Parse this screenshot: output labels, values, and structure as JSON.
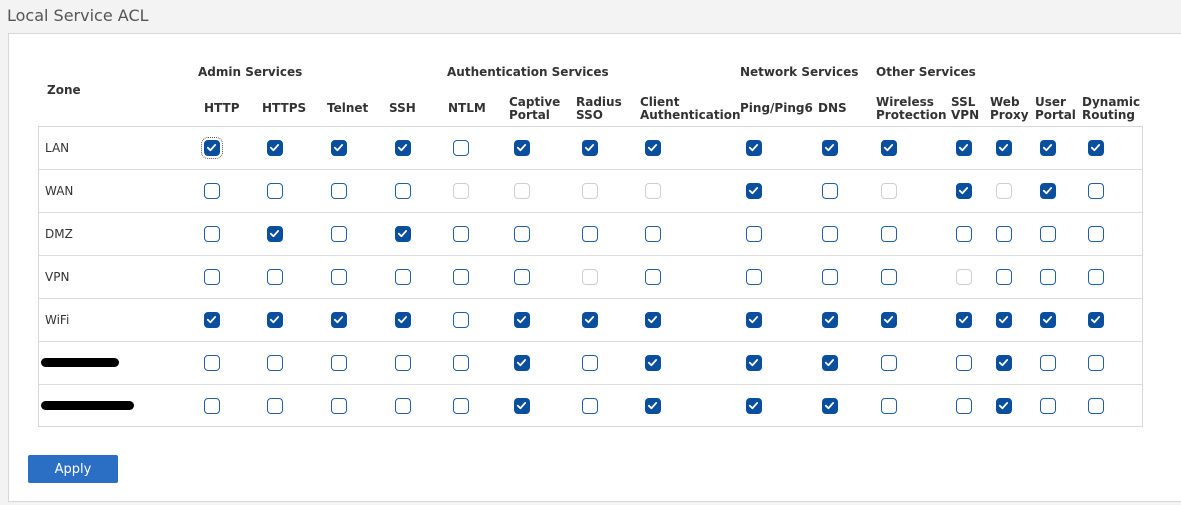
{
  "page": {
    "title": "Local Service ACL"
  },
  "table": {
    "zone_header": "Zone",
    "groups": [
      {
        "label": "Admin Services"
      },
      {
        "label": "Authentication Services"
      },
      {
        "label": "Network Services"
      },
      {
        "label": "Other Services"
      }
    ],
    "columns": [
      {
        "label": "HTTP"
      },
      {
        "label": "HTTPS"
      },
      {
        "label": "Telnet"
      },
      {
        "label": "SSH"
      },
      {
        "label": "NTLM"
      },
      {
        "label": "Captive\nPortal"
      },
      {
        "label": "Radius\nSSO"
      },
      {
        "label": "Client\nAuthentication"
      },
      {
        "label": "Ping/Ping6"
      },
      {
        "label": "DNS"
      },
      {
        "label": "Wireless\nProtection"
      },
      {
        "label": "SSL\nVPN"
      },
      {
        "label": "Web\nProxy"
      },
      {
        "label": "User\nPortal"
      },
      {
        "label": "Dynamic\nRouting"
      }
    ],
    "rows": [
      {
        "zone": "LAN",
        "redacted": false,
        "cells": [
          "checked",
          "checked",
          "checked",
          "checked",
          "unchecked",
          "checked",
          "checked",
          "checked",
          "checked",
          "checked",
          "checked",
          "checked",
          "checked",
          "checked",
          "checked"
        ]
      },
      {
        "zone": "WAN",
        "redacted": false,
        "cells": [
          "unchecked",
          "unchecked",
          "unchecked",
          "unchecked",
          "disabled",
          "disabled",
          "disabled",
          "disabled",
          "checked",
          "unchecked",
          "disabled",
          "checked",
          "disabled",
          "checked",
          "unchecked"
        ]
      },
      {
        "zone": "DMZ",
        "redacted": false,
        "cells": [
          "unchecked",
          "checked",
          "unchecked",
          "checked",
          "unchecked",
          "unchecked",
          "unchecked",
          "unchecked",
          "unchecked",
          "unchecked",
          "unchecked",
          "unchecked",
          "unchecked",
          "unchecked",
          "unchecked"
        ]
      },
      {
        "zone": "VPN",
        "redacted": false,
        "cells": [
          "unchecked",
          "unchecked",
          "unchecked",
          "unchecked",
          "unchecked",
          "unchecked",
          "disabled",
          "unchecked",
          "unchecked",
          "unchecked",
          "unchecked",
          "disabled",
          "unchecked",
          "unchecked",
          "unchecked"
        ]
      },
      {
        "zone": "WiFi",
        "redacted": false,
        "cells": [
          "checked",
          "checked",
          "checked",
          "checked",
          "unchecked",
          "checked",
          "checked",
          "checked",
          "checked",
          "checked",
          "checked",
          "checked",
          "checked",
          "checked",
          "checked"
        ]
      },
      {
        "zone": "",
        "redacted": true,
        "cells": [
          "unchecked",
          "unchecked",
          "unchecked",
          "unchecked",
          "unchecked",
          "checked",
          "unchecked",
          "checked",
          "checked",
          "checked",
          "unchecked",
          "unchecked",
          "checked",
          "unchecked",
          "unchecked"
        ]
      },
      {
        "zone": "",
        "redacted": true,
        "cells": [
          "unchecked",
          "unchecked",
          "unchecked",
          "unchecked",
          "unchecked",
          "checked",
          "unchecked",
          "checked",
          "checked",
          "checked",
          "unchecked",
          "unchecked",
          "checked",
          "unchecked",
          "unchecked"
        ]
      }
    ]
  },
  "actions": {
    "apply_label": "Apply"
  },
  "colors": {
    "accent": "#0a4f9e",
    "button": "#2a6fc4"
  },
  "icons": {
    "checkbox_mark": "check-icon"
  }
}
